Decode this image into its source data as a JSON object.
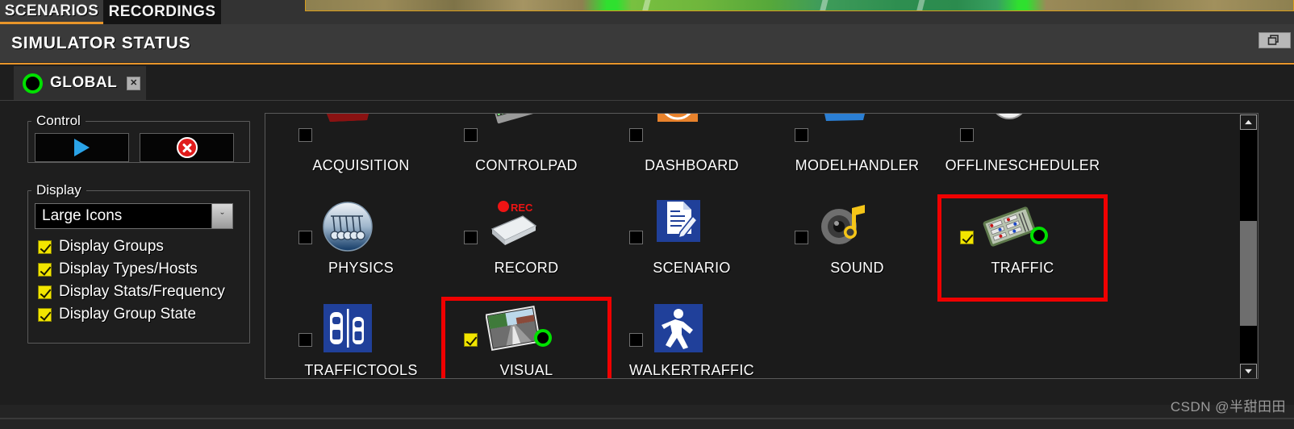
{
  "window": {
    "title": "SIMULATOR STATUS",
    "restore_button_icon": "restore-window-icon"
  },
  "top_tabs": [
    {
      "label": "SCENARIOS",
      "active": true
    },
    {
      "label": "RECORDINGS",
      "active": false
    }
  ],
  "thumbnail": {
    "name": "terrain-preview-thumbnail"
  },
  "group_tab": {
    "label": "GLOBAL",
    "state_led_color": "#00e000",
    "close_label": "✕"
  },
  "left_panel": {
    "control": {
      "legend": "Control",
      "play_label": "",
      "stop_label": ""
    },
    "display": {
      "legend": "Display",
      "view_mode": {
        "value": "Large Icons",
        "arrow": "ˇ"
      },
      "checkboxes": [
        {
          "label": "Display Groups",
          "checked": true
        },
        {
          "label": "Display Types/Hosts",
          "checked": true
        },
        {
          "label": "Display Stats/Frequency",
          "checked": true
        },
        {
          "label": "Display Group State",
          "checked": true
        }
      ]
    }
  },
  "modules": [
    {
      "label": "ACQUISITION",
      "icon": "car-red-icon",
      "checked": false,
      "running": false,
      "selected": false,
      "row": 0,
      "col": 0
    },
    {
      "label": "CONTROLPAD",
      "icon": "controlpad-icon",
      "checked": false,
      "running": false,
      "selected": false,
      "row": 0,
      "col": 1
    },
    {
      "label": "DASHBOARD",
      "icon": "dashboard-icon",
      "checked": false,
      "running": false,
      "selected": false,
      "row": 0,
      "col": 2
    },
    {
      "label": "MODELHANDLER",
      "icon": "car-blue-icon",
      "checked": false,
      "running": false,
      "selected": false,
      "row": 0,
      "col": 3
    },
    {
      "label": "OFFLINESCHEDULER",
      "icon": "clock-icon",
      "checked": false,
      "running": false,
      "selected": false,
      "row": 0,
      "col": 4
    },
    {
      "label": "PHYSICS",
      "icon": "newton-cradle-icon",
      "checked": false,
      "running": false,
      "selected": false,
      "row": 1,
      "col": 0
    },
    {
      "label": "RECORD",
      "icon": "record-disk-icon",
      "checked": false,
      "running": false,
      "selected": false,
      "row": 1,
      "col": 1
    },
    {
      "label": "SCENARIO",
      "icon": "document-pen-icon",
      "checked": false,
      "running": false,
      "selected": false,
      "row": 1,
      "col": 2
    },
    {
      "label": "SOUND",
      "icon": "speaker-note-icon",
      "checked": false,
      "running": false,
      "selected": false,
      "row": 1,
      "col": 3
    },
    {
      "label": "TRAFFIC",
      "icon": "traffic-board-icon",
      "checked": true,
      "running": true,
      "selected": true,
      "row": 1,
      "col": 4
    },
    {
      "label": "TRAFFICTOOLS",
      "icon": "two-cars-icon",
      "checked": false,
      "running": false,
      "selected": false,
      "row": 2,
      "col": 0
    },
    {
      "label": "VISUAL",
      "icon": "road-view-icon",
      "checked": true,
      "running": true,
      "selected": true,
      "row": 2,
      "col": 1
    },
    {
      "label": "WALKERTRAFFIC",
      "icon": "pedestrian-icon",
      "checked": false,
      "running": false,
      "selected": false,
      "row": 2,
      "col": 2
    }
  ],
  "scrollbar": {
    "up_arrow": "▲",
    "down_arrow": "▼"
  },
  "watermark": {
    "text": "CSDN @半甜田田"
  },
  "colors": {
    "accent": "#e8952a",
    "selection": "#f00000",
    "led_on": "#00e000",
    "checkbox": "#f2e500",
    "panel_bg": "#1e1e1e",
    "titlebar_bg": "#3a3a3a"
  }
}
